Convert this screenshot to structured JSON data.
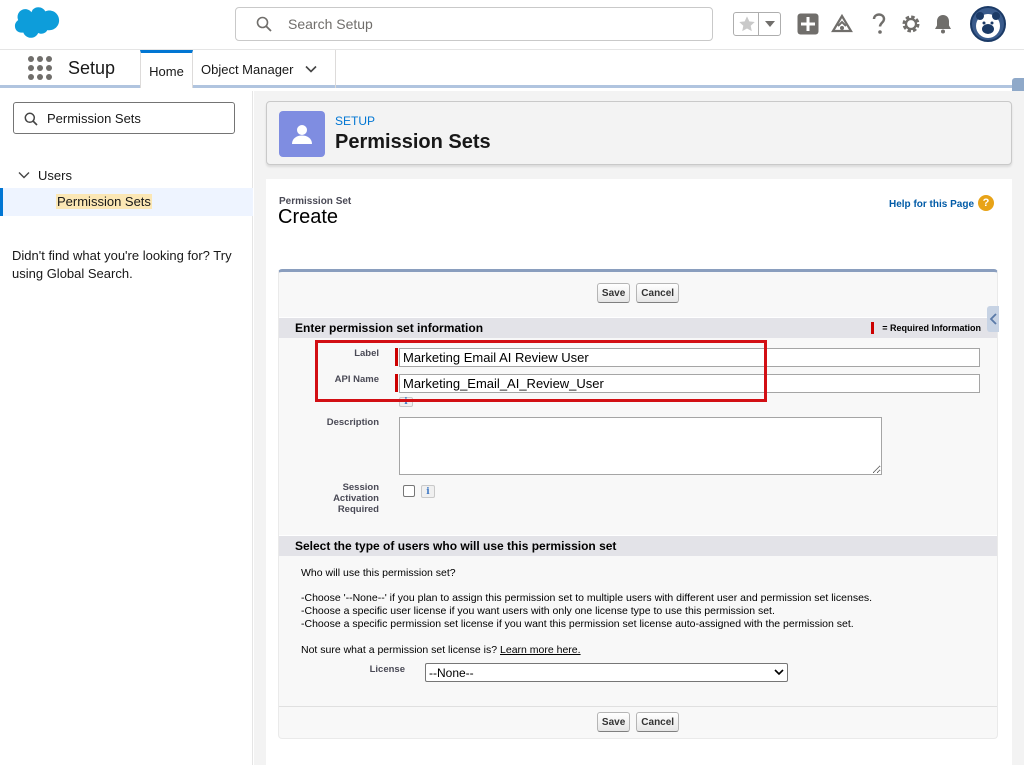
{
  "header": {
    "search_placeholder": "Search Setup"
  },
  "context": {
    "app_name": "Setup",
    "tabs": [
      {
        "label": "Home"
      },
      {
        "label": "Object Manager"
      }
    ]
  },
  "sidebar": {
    "quickfind_value": "Permission Sets",
    "tree": {
      "group_label": "Users",
      "selected_item": "Permission Sets"
    },
    "help_text": "Didn't find what you're looking for? Try using Global Search."
  },
  "page_header": {
    "eyebrow": "SETUP",
    "title": "Permission Sets"
  },
  "form": {
    "type_label": "Permission Set",
    "title": "Create",
    "help_link": "Help for this Page",
    "help_q": "?",
    "save_label": "Save",
    "cancel_label": "Cancel",
    "section1_title": "Enter permission set information",
    "required_legend": "= Required Information",
    "label_field_label": "Label",
    "label_value": "Marketing Email AI Review User",
    "api_field_label": "API Name",
    "api_value": "Marketing_Email_AI_Review_User",
    "description_label": "Description",
    "session_label_1": "Session",
    "session_label_2": "Activation",
    "session_label_3": "Required",
    "info_glyph": "i",
    "section2_title": "Select the type of users who will use this permission set",
    "who_text": "Who will use this permission set?",
    "choose_1": "-Choose '--None--' if you plan to assign this permission set to multiple users with different user and permission set licenses.",
    "choose_2": "-Choose a specific user license if you want users with only one license type to use this permission set.",
    "choose_3": "-Choose a specific permission set license if you want this permission set license auto-assigned with the permission set.",
    "not_sure_text": "Not sure what a permission set license is?",
    "learn_more": "Learn more here.",
    "license_label": "License",
    "license_selected": "--None--"
  },
  "colors": {
    "brand_blue": "#0176d3",
    "required_red": "#cc0000",
    "annotation_red": "#d20f14",
    "header_icon_bg": "#7f8de1"
  }
}
